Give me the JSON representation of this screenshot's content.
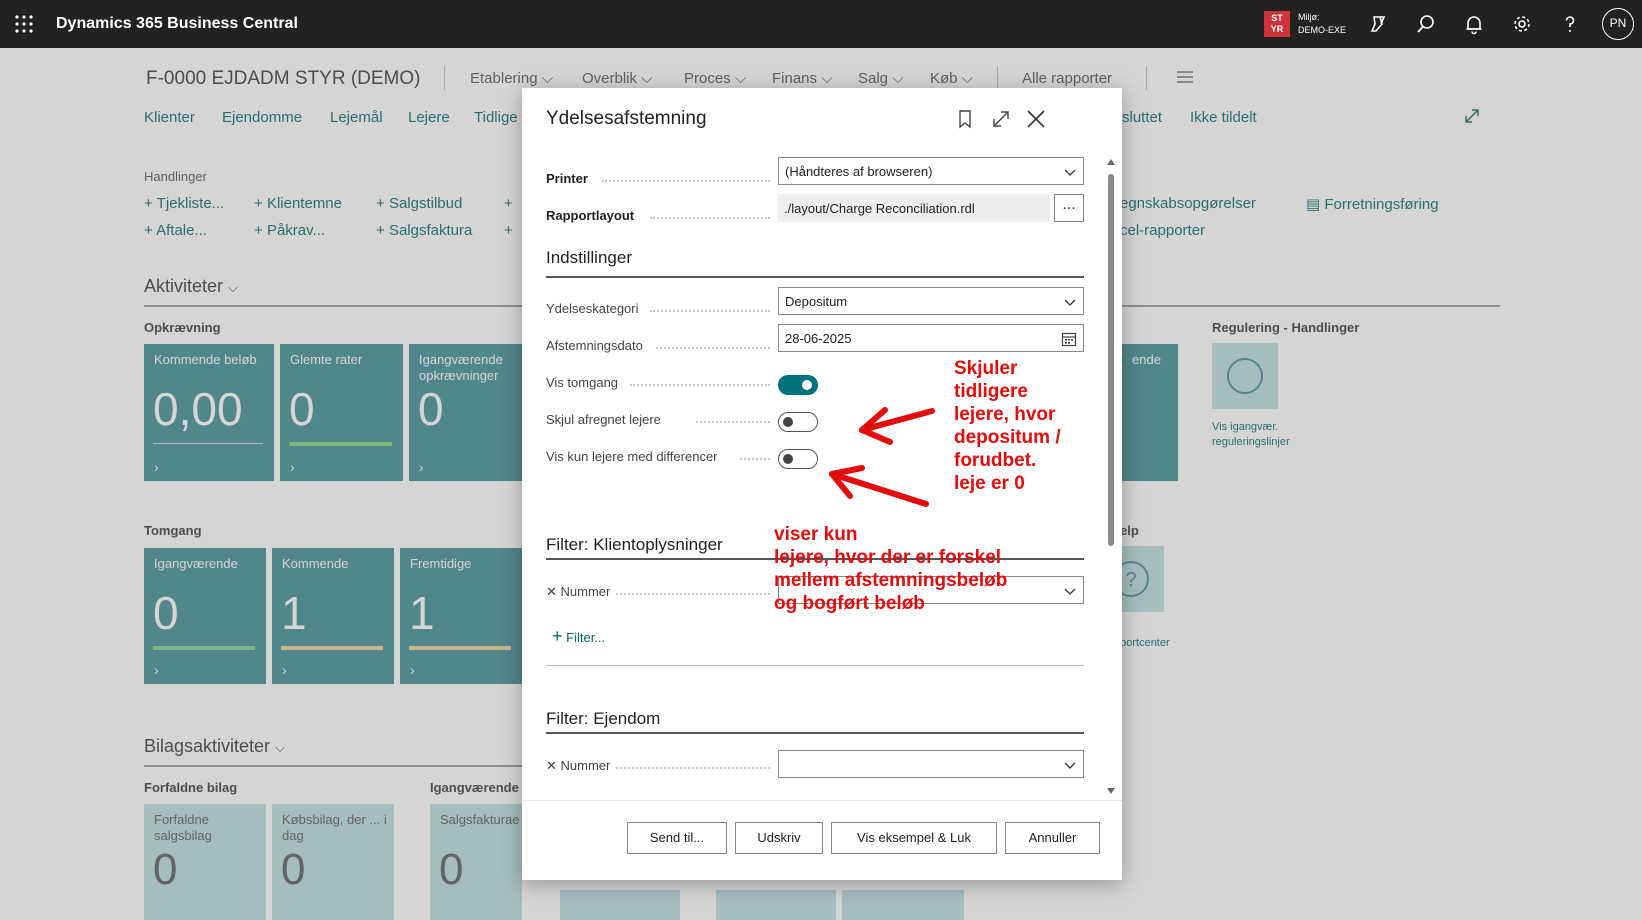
{
  "topbar": {
    "app_name": "Dynamics 365 Business Central",
    "env_badge": "ST YR",
    "env_label": "Miljø:",
    "env_name": "DEMO-EXE",
    "avatar": "PN"
  },
  "page": {
    "company": "F-0000 EJDADM STYR (DEMO)",
    "menu": [
      "Etablering",
      "Overblik",
      "Proces",
      "Finans",
      "Salg",
      "Køb"
    ],
    "all_reports": "Alle rapporter",
    "nav": [
      "Klienter",
      "Ejendomme",
      "Lejemål",
      "Lejere",
      "Tidlige"
    ],
    "nav_right": [
      "sluttet",
      "Ikke tildelt"
    ],
    "actions_label": "Handlinger",
    "actions_col1": [
      "Tjekliste...",
      "Aftale..."
    ],
    "actions_col2": [
      "Klientemne",
      "Påkrav..."
    ],
    "actions_col3": [
      "Salgstilbud",
      "Salgsfaktura"
    ],
    "actions_right": [
      "egnskabsopgørelser",
      "cel-rapporter"
    ],
    "actions_far_right": "Forretningsføring",
    "activities_heading": "Aktiviteter",
    "group1": "Opkrævning",
    "tiles1": [
      {
        "title": "Kommende beløb",
        "value": "0,00"
      },
      {
        "title": "Glemte rater",
        "value": "0"
      },
      {
        "title": "Igangværende opkrævninger",
        "value": "0"
      }
    ],
    "tile_right_title": "ende",
    "regulering_label": "Regulering - Handlinger",
    "regulering_link": "Vis igangvær. reguleringslinjer",
    "group2": "Tomgang",
    "tiles2": [
      {
        "title": "Igangværende",
        "value": "0"
      },
      {
        "title": "Kommende",
        "value": "1"
      },
      {
        "title": "Fremtidige",
        "value": "1"
      }
    ],
    "help_label": "elp",
    "help_link": "pportcenter",
    "bilag_heading": "Bilagsaktiviteter",
    "group3": "Forfaldne bilag",
    "group4": "Igangværende",
    "tiles3": [
      {
        "title": "Forfaldne salgsbilag",
        "value": "0"
      },
      {
        "title": "Købsbilag, der ... i dag",
        "value": "0"
      },
      {
        "title": "Salgsfakturae",
        "value": "0"
      }
    ]
  },
  "dialog": {
    "title": "Ydelsesafstemning",
    "printer_label": "Printer",
    "printer_value": "(Håndteres af browseren)",
    "layout_label": "Rapportlayout",
    "layout_value": "./layout/Charge Reconciliation.rdl",
    "ellipsis": "...",
    "settings_heading": "Indstillinger",
    "category_label": "Ydelseskategori",
    "category_value": "Depositum",
    "date_label": "Afstemningsdato",
    "date_value": "28-06-2025",
    "vis_tomgang_label": "Vis tomgang",
    "vis_tomgang": true,
    "skjul_label": "Skjul afregnet lejere",
    "skjul": false,
    "kun_diff_label": "Vis kun lejere med differencer",
    "kun_diff": false,
    "filter1_heading": "Filter: Klientoplysninger",
    "filter1_field": "Nummer",
    "add_filter": "Filter...",
    "filter2_heading": "Filter: Ejendom",
    "filter2_field": "Nummer",
    "buttons": {
      "send": "Send til...",
      "print": "Udskriv",
      "preview": "Vis eksempel & Luk",
      "cancel": "Annuller"
    }
  },
  "annotations": {
    "note1": [
      "Skjuler",
      "tidligere",
      "lejere, hvor",
      "depositum /",
      "forudbet.",
      "leje er 0"
    ],
    "note2": [
      "viser kun",
      "lejere, hvor der er forskel",
      "mellem afstemningsbeløb",
      "og bogført beløb"
    ],
    "color": "#e30b0b"
  },
  "colors": {
    "accent": "#00656b",
    "tile": "#3b8a8f",
    "topbar": "#222222",
    "env_badge": "#d13438"
  }
}
